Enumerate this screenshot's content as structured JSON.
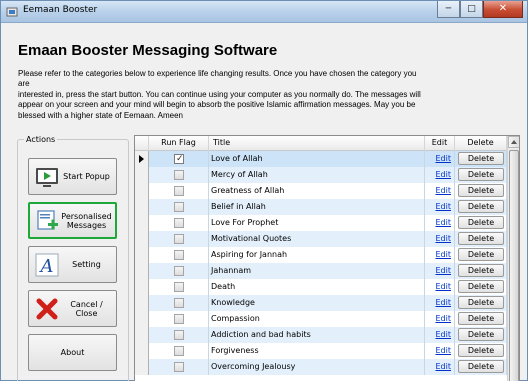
{
  "window": {
    "title": "Eemaan Booster",
    "min_symbol": "─",
    "max_symbol": "□",
    "close_symbol": "✕"
  },
  "heading": "Emaan Booster Messaging Software",
  "intro": {
    "line1": "Please refer to the categories below to experience life changing results. Once you  have chosen the category you are",
    "line2": "interested in, press the start button. You can continue using your computer as you normally do. The messages will",
    "line3": "appear on your screen and your mind will begin to absorb the positive Islamic affirmation messages. May you be",
    "line4": "blessed with a higher state of Eemaan. Ameen"
  },
  "actions": {
    "legend": "Actions",
    "buttons": [
      {
        "label": "Start Popup",
        "icon": "monitor-play-icon"
      },
      {
        "label": "Personalised Messages",
        "icon": "add-message-icon",
        "selected": true
      },
      {
        "label": "Setting",
        "icon": "font-a-icon"
      },
      {
        "label": "Cancel / Close",
        "icon": "red-x-icon"
      },
      {
        "label": "About",
        "icon": ""
      }
    ]
  },
  "grid": {
    "columns": {
      "run_flag": "Run Flag",
      "title": "Title",
      "edit": "Edit",
      "delete": "Delete"
    },
    "edit_label": "Edit",
    "delete_label": "Delete",
    "rows": [
      {
        "title": "Love of Allah",
        "checked": true,
        "selected": true
      },
      {
        "title": "Mercy of Allah",
        "checked": false
      },
      {
        "title": "Greatness of Allah",
        "checked": false
      },
      {
        "title": "Belief in Allah",
        "checked": false
      },
      {
        "title": "Love For Prophet",
        "checked": false
      },
      {
        "title": "Motivational Quotes",
        "checked": false
      },
      {
        "title": "Aspiring for Jannah",
        "checked": false
      },
      {
        "title": "Jahannam",
        "checked": false
      },
      {
        "title": "Death",
        "checked": false
      },
      {
        "title": "Knowledge",
        "checked": false
      },
      {
        "title": "Compassion",
        "checked": false
      },
      {
        "title": "Addiction and bad habits",
        "checked": false
      },
      {
        "title": "Forgiveness",
        "checked": false
      },
      {
        "title": "Overcoming Jealousy",
        "checked": false
      }
    ]
  },
  "colors": {
    "selected_border": "#1fa83a",
    "link": "#0033cc",
    "row_alt": "#e3f0fb"
  }
}
